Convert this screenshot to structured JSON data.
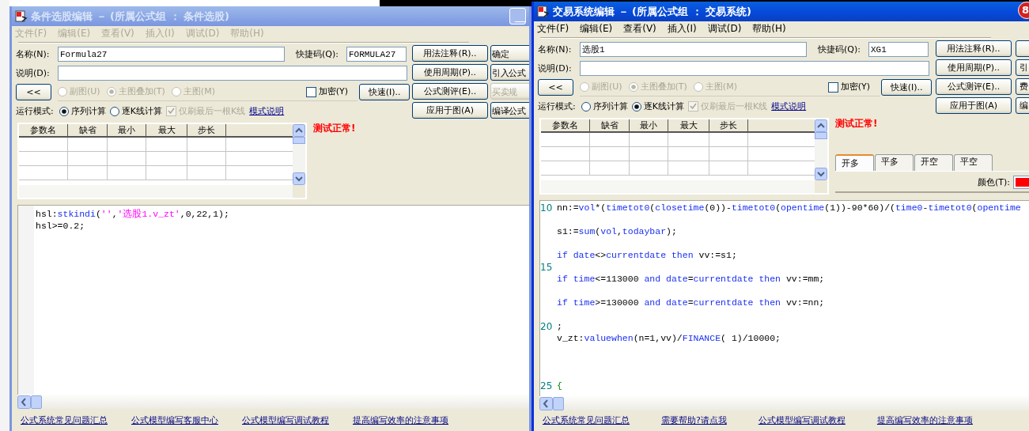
{
  "windows": [
    {
      "title": "条件选股编辑 － (所属公式组 ： 条件选股)",
      "active": false,
      "menu_enabled": false,
      "menu": [
        "文件(F)",
        "编辑(E)",
        "查看(V)",
        "插入(I)",
        "调试(D)",
        "帮助(H)"
      ],
      "name_label": "名称(N):",
      "name": "Formula27",
      "shortcut_label": "快捷码(Q):",
      "shortcut": "FORMULA27",
      "description_label": "说明(D):",
      "collapse_button": "<<",
      "display_options": [
        {
          "label": "副图(U)",
          "selected": false,
          "disabled": true
        },
        {
          "label": "主图叠加(T)",
          "selected": true,
          "disabled": true
        },
        {
          "label": "主图(M)",
          "selected": false,
          "disabled": true
        }
      ],
      "encrypt": {
        "label": "加密(Y)",
        "checked": false
      },
      "quick_button": "快速(I)..",
      "run_mode_label": "运行模式:",
      "run_modes": [
        {
          "label": "序列计算",
          "selected": true
        },
        {
          "label": "逐K线计算",
          "selected": false
        }
      ],
      "refresh_last": {
        "label": "仅刷最后一根K线",
        "checked": true,
        "disabled": true
      },
      "mode_link": "模式说明",
      "side_buttons": [
        "用法注释(R)..",
        "使用周期(P)..",
        "公式测评(E)..",
        "应用于图(A)"
      ],
      "edge_buttons": [
        {
          "label": "确定",
          "disabled": false
        },
        {
          "label": "引入公式",
          "disabled": false
        },
        {
          "label": "买卖规",
          "disabled": true
        },
        {
          "label": "编译公式",
          "disabled": false
        }
      ],
      "param_columns": [
        "参数名",
        "缺省",
        "最小",
        "最大",
        "步长"
      ],
      "status": "测试正常!",
      "code_lines": [
        {
          "kind": "code",
          "tokens": [
            {
              "kind": "plain",
              "text": "hsl:"
            },
            {
              "kind": "function",
              "text": "stkindi"
            },
            {
              "kind": "plain",
              "text": "("
            },
            {
              "kind": "string",
              "text": "''"
            },
            {
              "kind": "plain",
              "text": ","
            },
            {
              "kind": "string",
              "text": "'选股1.v_zt'"
            },
            {
              "kind": "plain",
              "text": ",0,22,1);"
            }
          ]
        },
        {
          "kind": "code",
          "tokens": [
            {
              "kind": "plain",
              "text": "hsl>=0.2;"
            }
          ]
        }
      ],
      "links": [
        "公式系统常见问题汇总",
        "公式模型编写客服中心",
        "公式模型编写调试教程",
        "提高编写效率的注意事项"
      ]
    },
    {
      "title": "交易系统编辑 － (所属公式组 ： 交易系统)",
      "active": true,
      "menu_enabled": true,
      "menu": [
        "文件(F)",
        "编辑(E)",
        "查看(V)",
        "插入(I)",
        "调试(D)",
        "帮助(H)"
      ],
      "name_label": "名称(N):",
      "name": "选股1",
      "shortcut_label": "快捷码(Q):",
      "shortcut": "XG1",
      "description_label": "说明(D):",
      "collapse_button": "<<",
      "display_options": [
        {
          "label": "副图(U)",
          "selected": false,
          "disabled": true
        },
        {
          "label": "主图叠加(T)",
          "selected": true,
          "disabled": true
        },
        {
          "label": "主图(M)",
          "selected": false,
          "disabled": true
        }
      ],
      "encrypt": {
        "label": "加密(Y)",
        "checked": false
      },
      "quick_button": "快速(I)..",
      "run_mode_label": "运行模式:",
      "run_modes": [
        {
          "label": "序列计算",
          "selected": false
        },
        {
          "label": "逐K线计算",
          "selected": true
        }
      ],
      "refresh_last": {
        "label": "仅刷最后一根K线",
        "checked": true,
        "disabled": true
      },
      "mode_link": "模式说明",
      "side_buttons": [
        "用法注释(R)..",
        "使用周期(P)..",
        "公式测评(E)..",
        "应用于图(A)"
      ],
      "edge_buttons": [
        {
          "disabled": false
        },
        {
          "label": "引",
          "disabled": false
        },
        {
          "label": "费",
          "disabled": false
        },
        {
          "label": "编",
          "disabled": false
        }
      ],
      "param_columns": [
        "参数名",
        "缺省",
        "最小",
        "最大",
        "步长"
      ],
      "status": "测试正常!",
      "signal_tabs": [
        {
          "label": "开多",
          "selected": true
        },
        {
          "label": "平多",
          "selected": false
        },
        {
          "label": "开空",
          "selected": false
        },
        {
          "label": "平空",
          "selected": false
        }
      ],
      "color_field": {
        "label": "颜色(T):",
        "color": "#ff0000"
      },
      "code_lines": [
        {
          "kind": "code",
          "number": "10",
          "tokens": [
            {
              "kind": "plain",
              "text": "nn:="
            },
            {
              "kind": "function",
              "text": "vol"
            },
            {
              "kind": "plain",
              "text": "*("
            },
            {
              "kind": "function",
              "text": "timetot0"
            },
            {
              "kind": "plain",
              "text": "("
            },
            {
              "kind": "function",
              "text": "closetime"
            },
            {
              "kind": "plain",
              "text": "(0))-"
            },
            {
              "kind": "function",
              "text": "timetot0"
            },
            {
              "kind": "plain",
              "text": "("
            },
            {
              "kind": "function",
              "text": "opentime"
            },
            {
              "kind": "plain",
              "text": "(1))-90*60)/("
            },
            {
              "kind": "function",
              "text": "time0"
            },
            {
              "kind": "plain",
              "text": "-"
            },
            {
              "kind": "function",
              "text": "timetot0"
            },
            {
              "kind": "plain",
              "text": "("
            },
            {
              "kind": "function",
              "text": "opentime"
            }
          ]
        },
        {
          "kind": "blank"
        },
        {
          "kind": "code",
          "tokens": [
            {
              "kind": "plain",
              "text": "s1:="
            },
            {
              "kind": "function",
              "text": "sum"
            },
            {
              "kind": "plain",
              "text": "("
            },
            {
              "kind": "function",
              "text": "vol"
            },
            {
              "kind": "plain",
              "text": ","
            },
            {
              "kind": "function",
              "text": "todaybar"
            },
            {
              "kind": "plain",
              "text": ");"
            }
          ]
        },
        {
          "kind": "blank"
        },
        {
          "kind": "code",
          "tokens": [
            {
              "kind": "keyword",
              "text": "if"
            },
            {
              "kind": "function",
              "text": " date"
            },
            {
              "kind": "plain",
              "text": "<>"
            },
            {
              "kind": "function",
              "text": "currentdate"
            },
            {
              "kind": "keyword",
              "text": " then"
            },
            {
              "kind": "plain",
              "text": " vv:=s1;"
            }
          ]
        },
        {
          "kind": "blank",
          "number": "15"
        },
        {
          "kind": "code",
          "tokens": [
            {
              "kind": "keyword",
              "text": "if"
            },
            {
              "kind": "function",
              "text": " time"
            },
            {
              "kind": "plain",
              "text": "<=113000 "
            },
            {
              "kind": "keyword",
              "text": "and"
            },
            {
              "kind": "function",
              "text": " date"
            },
            {
              "kind": "plain",
              "text": "="
            },
            {
              "kind": "function",
              "text": "currentdate"
            },
            {
              "kind": "keyword",
              "text": " then"
            },
            {
              "kind": "plain",
              "text": " vv:=mm;"
            }
          ]
        },
        {
          "kind": "blank"
        },
        {
          "kind": "code",
          "tokens": [
            {
              "kind": "keyword",
              "text": "if"
            },
            {
              "kind": "function",
              "text": " time"
            },
            {
              "kind": "plain",
              "text": ">=130000 "
            },
            {
              "kind": "keyword",
              "text": "and"
            },
            {
              "kind": "function",
              "text": " date"
            },
            {
              "kind": "plain",
              "text": "="
            },
            {
              "kind": "function",
              "text": "currentdate"
            },
            {
              "kind": "keyword",
              "text": " then"
            },
            {
              "kind": "plain",
              "text": " vv:=nn;"
            }
          ]
        },
        {
          "kind": "blank"
        },
        {
          "kind": "code",
          "number": "20",
          "tokens": [
            {
              "kind": "plain",
              "text": ";"
            }
          ]
        },
        {
          "kind": "code",
          "tokens": [
            {
              "kind": "plain",
              "text": "v_zt:"
            },
            {
              "kind": "function",
              "text": "valuewhen"
            },
            {
              "kind": "plain",
              "text": "(n=1,vv)/"
            },
            {
              "kind": "function",
              "text": "FINANCE"
            },
            {
              "kind": "plain",
              "text": "( 1)/10000;"
            }
          ]
        },
        {
          "kind": "blank"
        },
        {
          "kind": "blank"
        },
        {
          "kind": "blank"
        },
        {
          "kind": "code",
          "number": "25",
          "tokens": [
            {
              "kind": "comment",
              "text": "{"
            }
          ]
        }
      ],
      "links": [
        "公式系统常见问题汇总",
        "需要帮助?请点我",
        "公式模型编写调试教程",
        "提高编写效率的注意事项"
      ]
    }
  ],
  "notification_badge": "8"
}
